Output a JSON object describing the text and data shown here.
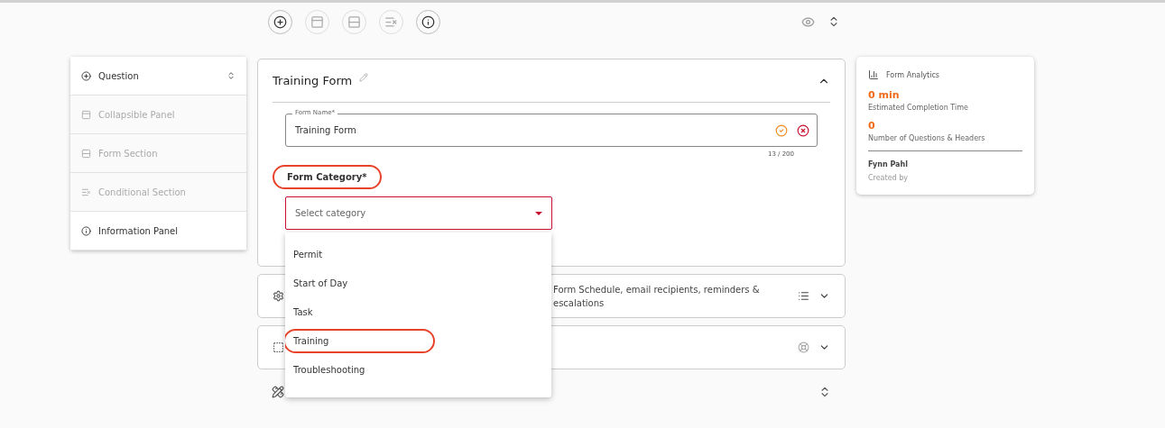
{
  "toolbar": {
    "tools": [
      {
        "kind": "add",
        "disabled": false
      },
      {
        "kind": "panel",
        "disabled": true
      },
      {
        "kind": "section",
        "disabled": true
      },
      {
        "kind": "conditional",
        "disabled": true
      },
      {
        "kind": "info",
        "disabled": false
      }
    ]
  },
  "sidebar": {
    "items": [
      {
        "kind": "add",
        "label": "Question",
        "disabled": false,
        "expandable": true
      },
      {
        "kind": "panel",
        "label": "Collapsible Panel",
        "disabled": true,
        "expandable": false
      },
      {
        "kind": "section",
        "label": "Form Section",
        "disabled": true,
        "expandable": false
      },
      {
        "kind": "conditional",
        "label": "Conditional Section",
        "disabled": true,
        "expandable": false
      },
      {
        "kind": "info",
        "label": "Information Panel",
        "disabled": false,
        "expandable": false
      }
    ]
  },
  "form_card": {
    "title": "Training Form",
    "expanded": true,
    "name_field": {
      "label": "Form Name*",
      "value": "Training Form",
      "counter": "13 / 200"
    },
    "category": {
      "label": "Form Category*",
      "label_circled": true,
      "placeholder": "Select category",
      "error": true,
      "options": [
        {
          "label": "Permit",
          "circled": false
        },
        {
          "label": "Start of Day",
          "circled": false
        },
        {
          "label": "Task",
          "circled": false
        },
        {
          "label": "Training",
          "circled": true
        },
        {
          "label": "Troubleshooting",
          "circled": false
        }
      ]
    }
  },
  "panels": [
    {
      "kind": "schedule",
      "text": "Form Schedule, email recipients, reminders & escalations"
    },
    {
      "kind": "settings"
    }
  ],
  "analytics": {
    "title": "Form Analytics",
    "stats": [
      {
        "value": "0 min",
        "label": "Estimated Completion Time"
      },
      {
        "value": "0",
        "label": "Number of Questions & Headers"
      }
    ],
    "author": "Fynn Pahl",
    "author_label": "Created by"
  }
}
